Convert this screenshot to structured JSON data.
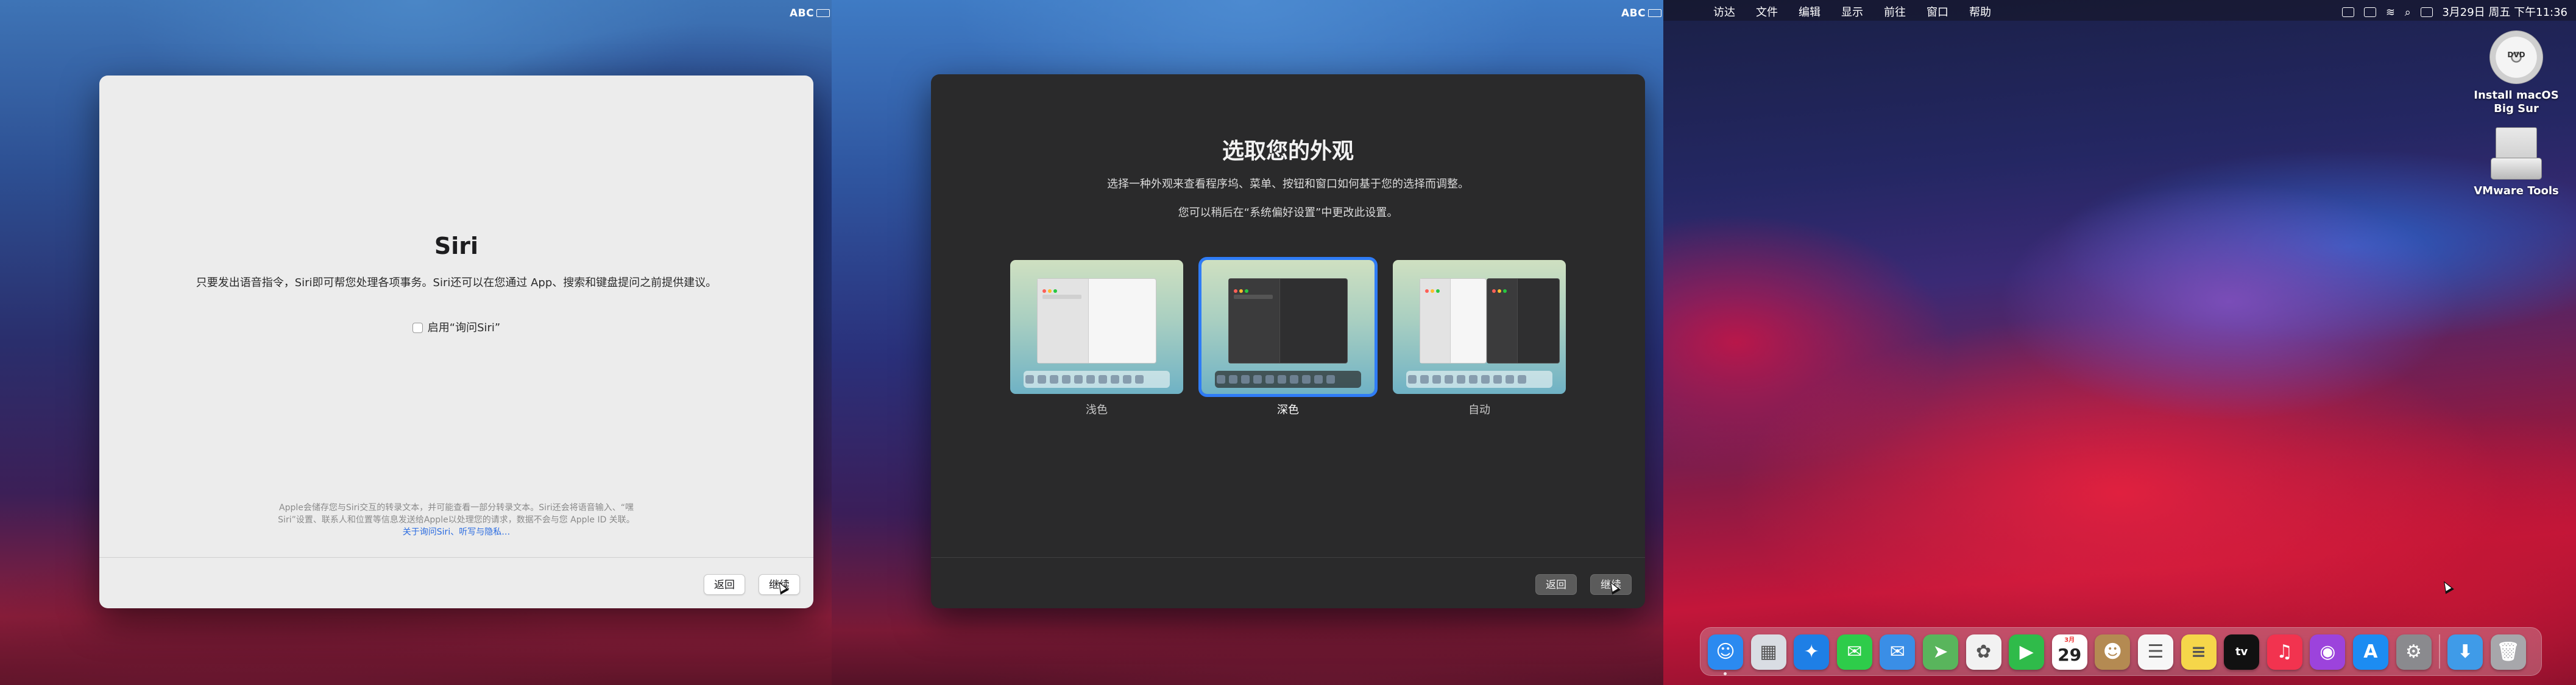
{
  "input_indicator": "ABC",
  "siri": {
    "title": "Siri",
    "description": "只要发出语音指令，Siri即可帮您处理各项事务。Siri还可以在您通过 App、搜索和键盘提问之前提供建议。",
    "checkbox_label": "启用“询问Siri”",
    "note_line1": "Apple会储存您与Siri交互的转录文本，并可能查看一部分转录文本。Siri还会将语音输入、“嘿",
    "note_line2": "Siri”设置、联系人和位置等信息发送给Apple以处理您的请求，数据不会与您 Apple ID 关联。",
    "link": "关于询问Siri、听写与隐私…",
    "back_label": "返回",
    "continue_label": "继续"
  },
  "appearance": {
    "title": "选取您的外观",
    "subtitle": "选择一种外观来查看程序坞、菜单、按钮和窗口如何基于您的选择而调整。",
    "subtitle2": "您可以稍后在“系统偏好设置”中更改此设置。",
    "options": [
      {
        "label": "浅色",
        "selected": false
      },
      {
        "label": "深色",
        "selected": true
      },
      {
        "label": "自动",
        "selected": false
      }
    ],
    "back_label": "返回",
    "continue_label": "继续"
  },
  "desktop": {
    "menu": [
      "访达",
      "文件",
      "编辑",
      "显示",
      "前往",
      "窗口",
      "帮助"
    ],
    "clock": "3月29日 周五 下午11:36",
    "icons": [
      {
        "name": "Install macOS Big Sur",
        "type": "dvd-icon"
      },
      {
        "name": "VMware Tools",
        "type": "drive-icon"
      }
    ],
    "calendar": {
      "month": "3月",
      "day": "29"
    },
    "dock_apps": [
      {
        "name": "Finder",
        "color": "#2b8af0",
        "glyph": "☺"
      },
      {
        "name": "Launchpad",
        "color": "#d9dde3",
        "glyph": "▦"
      },
      {
        "name": "Safari",
        "color": "#1e7fe6",
        "glyph": "✦"
      },
      {
        "name": "Messages",
        "color": "#2ecc4a",
        "glyph": "✉"
      },
      {
        "name": "Mail",
        "color": "#3a8ee6",
        "glyph": "✉"
      },
      {
        "name": "Maps",
        "color": "#59b55c",
        "glyph": "➤"
      },
      {
        "name": "Photos",
        "color": "#f2f2f2",
        "glyph": "✿"
      },
      {
        "name": "FaceTime",
        "color": "#2fbb4a",
        "glyph": "▶"
      },
      {
        "name": "Calendar",
        "color": "#ffffff",
        "glyph": ""
      },
      {
        "name": "Contacts",
        "color": "#b48a52",
        "glyph": "☻"
      },
      {
        "name": "Reminders",
        "color": "#f7f7f7",
        "glyph": "☰"
      },
      {
        "name": "Notes",
        "color": "#f5d64a",
        "glyph": "≡"
      },
      {
        "name": "Apple TV",
        "color": "#111111",
        "glyph": "tv"
      },
      {
        "name": "Music",
        "color": "#f2334f",
        "glyph": "♫"
      },
      {
        "name": "Podcasts",
        "color": "#9c43dc",
        "glyph": "◉"
      },
      {
        "name": "App Store",
        "color": "#1c8cf2",
        "glyph": "A"
      },
      {
        "name": "System Preferences",
        "color": "#8a8a8e",
        "glyph": "⚙"
      },
      {
        "name": "Downloads",
        "color": "#3f9be8",
        "glyph": "⬇"
      },
      {
        "name": "Trash",
        "color": "#a7a7ab",
        "glyph": "🗑"
      }
    ]
  }
}
